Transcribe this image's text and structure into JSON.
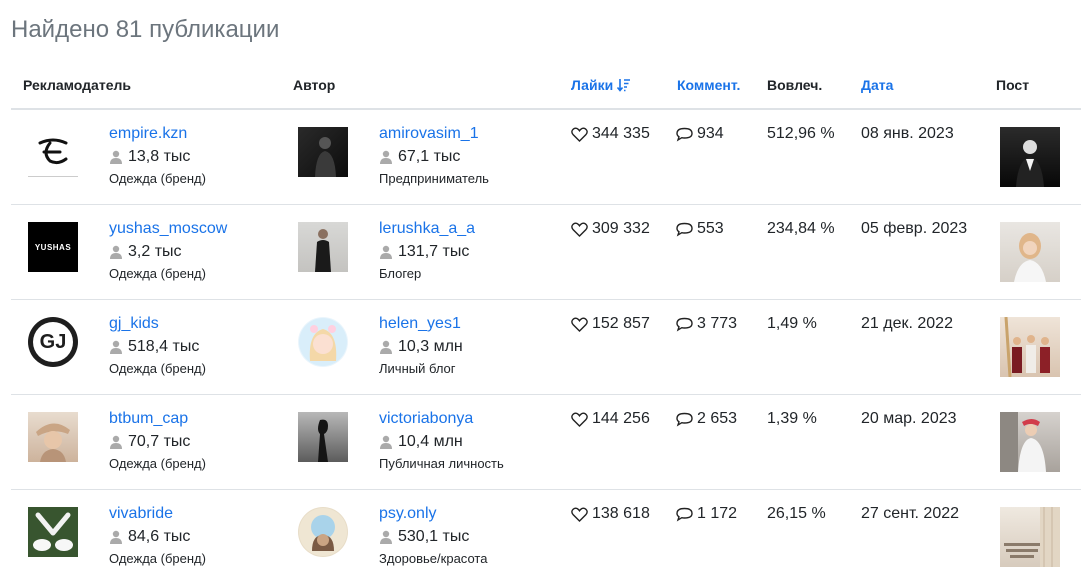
{
  "page_title": "Найдено 81 публикации",
  "headers": {
    "advertiser": "Рекламодатель",
    "author": "Автор",
    "likes": "Лайки",
    "comments": "Коммент.",
    "engagement": "Вовлеч.",
    "date": "Дата",
    "post": "Пост"
  },
  "rows": [
    {
      "advertiser": {
        "name": "empire.kzn",
        "subs": "13,8 тыс",
        "cat": "Одежда (бренд)"
      },
      "author": {
        "name": "amirovasim_1",
        "subs": "67,1 тыс",
        "cat": "Предприниматель"
      },
      "likes": "344 335",
      "comments": "934",
      "engagement": "512,96 %",
      "date": "08 янв. 2023"
    },
    {
      "advertiser": {
        "name": "yushas_moscow",
        "subs": "3,2 тыс",
        "cat": "Одежда (бренд)",
        "logo_text": "YUSHAS"
      },
      "author": {
        "name": "lerushka_a_a",
        "subs": "131,7 тыс",
        "cat": "Блогер"
      },
      "likes": "309 332",
      "comments": "553",
      "engagement": "234,84 %",
      "date": "05 февр. 2023"
    },
    {
      "advertiser": {
        "name": "gj_kids",
        "subs": "518,4 тыс",
        "cat": "Одежда (бренд)",
        "logo_text": "GJ"
      },
      "author": {
        "name": "helen_yes1",
        "subs": "10,3 млн",
        "cat": "Личный блог"
      },
      "likes": "152 857",
      "comments": "3 773",
      "engagement": "1,49 %",
      "date": "21 дек. 2022"
    },
    {
      "advertiser": {
        "name": "btbum_cap",
        "subs": "70,7 тыс",
        "cat": "Одежда (бренд)"
      },
      "author": {
        "name": "victoriabonya",
        "subs": "10,4 млн",
        "cat": "Публичная личность"
      },
      "likes": "144 256",
      "comments": "2 653",
      "engagement": "1,39 %",
      "date": "20 мар. 2023"
    },
    {
      "advertiser": {
        "name": "vivabride",
        "subs": "84,6 тыс",
        "cat": "Одежда (бренд)"
      },
      "author": {
        "name": "psy.only",
        "subs": "530,1 тыс",
        "cat": "Здоровье/красота"
      },
      "likes": "138 618",
      "comments": "1 172",
      "engagement": "26,15 %",
      "date": "27 сент. 2022"
    }
  ]
}
